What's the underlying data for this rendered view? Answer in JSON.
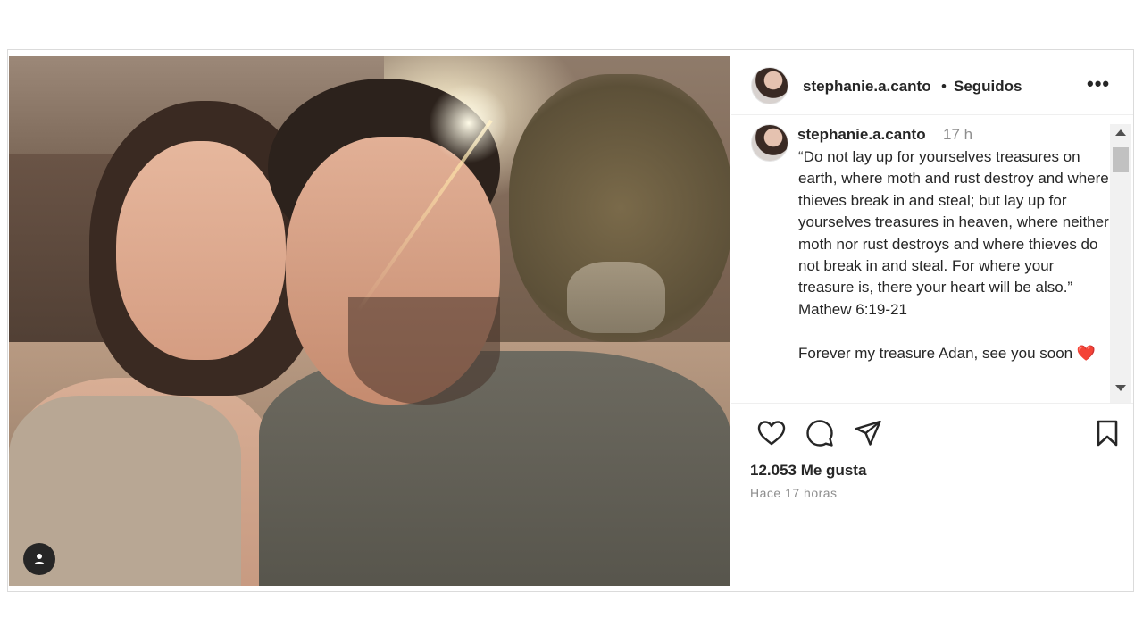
{
  "post": {
    "header": {
      "username": "stephanie.a.canto",
      "separator": "•",
      "follow_status": "Seguidos",
      "more_icon": "more-options-icon"
    },
    "caption": {
      "username": "stephanie.a.canto",
      "time": "17 h",
      "text": "“Do not lay up for yourselves treasures on earth, where moth and rust destroy and where thieves break in and steal; but lay up for yourselves treasures in heaven, where neither moth nor rust destroys and where thieves do not break in and steal. For where your treasure is, there your heart will be also.” Mathew 6:19-21\n\nForever my treasure Adan, see you soon",
      "emoji": "❤️"
    },
    "actions": {
      "like_icon": "heart-icon",
      "comment_icon": "comment-icon",
      "share_icon": "send-icon",
      "save_icon": "bookmark-icon"
    },
    "likes": "12.053 Me gusta",
    "posted": "Hace 17 horas",
    "tag_icon": "user-tag-icon",
    "colors": {
      "text": "#262626",
      "muted": "#8e8e8e",
      "heart": "#d7263d",
      "border": "#dbdbdb"
    }
  }
}
